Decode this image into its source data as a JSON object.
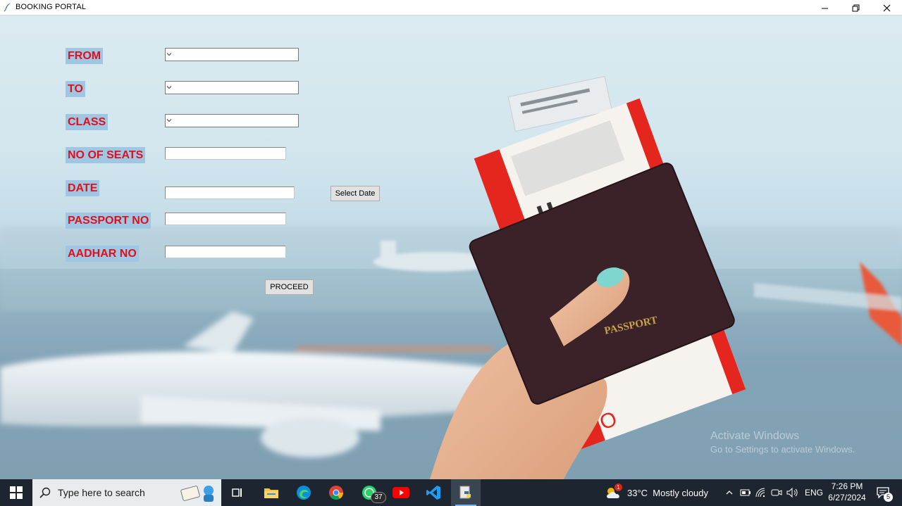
{
  "window": {
    "title": "BOOKING PORTAL",
    "icon": "feather-icon"
  },
  "form": {
    "from_label": "FROM",
    "to_label": "TO",
    "class_label": "CLASS",
    "seats_label": "NO OF SEATS",
    "date_label": "DATE",
    "passport_label": "PASSPORT NO",
    "aadhar_label": "AADHAR NO",
    "from_value": "",
    "to_value": "",
    "class_value": "",
    "seats_value": "",
    "date_value": "",
    "passport_value": "",
    "aadhar_value": "",
    "select_date_button": "Select Date",
    "proceed_button": "PROCEED"
  },
  "background": {
    "passport_text": "PASSPORT",
    "ticket_text": "BO"
  },
  "watermark": {
    "line1": "Activate Windows",
    "line2": "Go to Settings to activate Windows."
  },
  "taskbar": {
    "search_placeholder": "Type here to search",
    "apps": [
      "task-view",
      "file-explorer",
      "edge",
      "chrome",
      "whatsapp",
      "youtube",
      "vscode",
      "python"
    ],
    "whatsapp_badge": "37",
    "weather_badge": "1",
    "weather": "33°C  Mostly cloudy",
    "language": "ENG",
    "time": "7:26 PM",
    "date": "6/27/2024",
    "notifications": "5"
  },
  "colors": {
    "label_text": "#e0101b",
    "label_bg": "#9fc7e3",
    "taskbar": "#1c2530"
  }
}
